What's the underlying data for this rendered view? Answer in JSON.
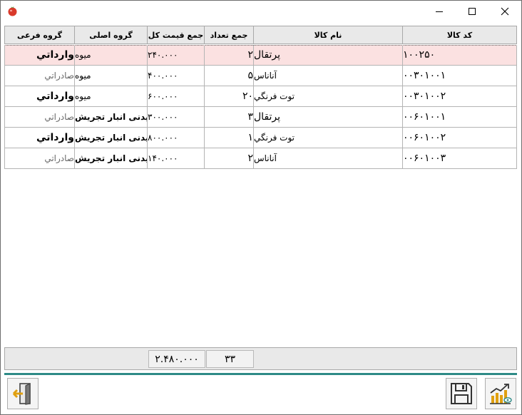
{
  "window": {
    "title": ""
  },
  "grid": {
    "columns": [
      {
        "key": "code",
        "label": "کد کالا"
      },
      {
        "key": "name",
        "label": "نام کالا"
      },
      {
        "key": "qty",
        "label": "جمع تعداد"
      },
      {
        "key": "total",
        "label": "جمع قیمت کل"
      },
      {
        "key": "group",
        "label": "گروه اصلی"
      },
      {
        "key": "subgroup",
        "label": "گروه فرعی"
      }
    ],
    "rows": [
      {
        "code": "۱۰۰۲۵۰",
        "name": "پرتقال",
        "qty": "۲",
        "total": "۲۴۰.۰۰۰",
        "group": "میوه",
        "subgroup": "وارداتي"
      },
      {
        "code": "۰۰۳۰۱۰۰۱",
        "name": "آناناس",
        "qty": "۵",
        "total": "۴۰۰.۰۰۰",
        "group": "میوه",
        "subgroup": "صادراتي"
      },
      {
        "code": "۰۰۳۰۱۰۰۲",
        "name": "توت فرنگي",
        "qty": "۲۰",
        "total": "۶۰۰.۰۰۰",
        "group": "میوه",
        "subgroup": "وارداتي"
      },
      {
        "code": "۰۰۶۰۱۰۰۱",
        "name": "پرتقال",
        "qty": "۳",
        "total": "۳۰۰.۰۰۰",
        "group": "بیدنی انبار تجریش",
        "subgroup": "صادراتي"
      },
      {
        "code": "۰۰۶۰۱۰۰۲",
        "name": "توت فرنگي",
        "qty": "۱",
        "total": "۸۰۰.۰۰۰",
        "group": "بیدنی انبار تجریش",
        "subgroup": "وارداتي"
      },
      {
        "code": "۰۰۶۰۱۰۰۳",
        "name": "آناناس",
        "qty": "۲",
        "total": "۱۴۰.۰۰۰",
        "group": "بیدنی انبار تجریش",
        "subgroup": "صادراتي"
      }
    ],
    "selected_row": 0
  },
  "footer": {
    "qty_sum": "۳۳",
    "total_sum": "۲.۴۸۰.۰۰۰"
  },
  "toolbar": {
    "exit_icon": "exit-door-icon",
    "save_icon": "floppy-disk-icon",
    "report_icon": "chart-trend-icon"
  },
  "colors": {
    "accent": "#2e8b87",
    "selected_row": "#fbe1e1",
    "header_bg": "#e9e9e9"
  }
}
